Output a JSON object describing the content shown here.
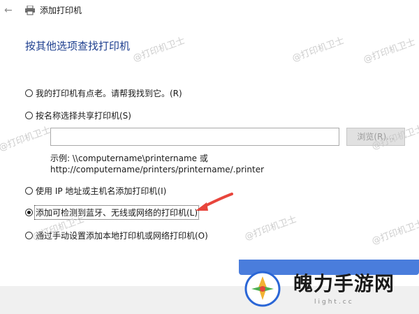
{
  "window": {
    "title": "添加打印机"
  },
  "heading": "按其他选项查找打印机",
  "options": [
    {
      "label": "我的打印机有点老。请帮我找到它。(R)",
      "checked": false
    },
    {
      "label": "按名称选择共享打印机(S)",
      "checked": false
    },
    {
      "label": "使用 IP 地址或主机名添加打印机(I)",
      "checked": false
    },
    {
      "label": "添加可检测到蓝牙、无线或网络的打印机(L)",
      "checked": true
    },
    {
      "label": "通过手动设置添加本地打印机或网络打印机(O)",
      "checked": false
    }
  ],
  "share_input": {
    "value": ""
  },
  "browse_label": "浏览(R)...",
  "example_line1": "示例: \\\\computername\\printername 或",
  "example_line2": "http://computername/printers/printername/.printer",
  "watermarks": [
    "@打印机卫士",
    "@打印机卫士",
    "@打印机卫士",
    "@打印机卫士",
    "@打印机卫士",
    "@打印机卫士",
    "@打印机卫士",
    "@打印机卫士"
  ],
  "logo": {
    "name": "魄力手游网",
    "url": "light.cc"
  },
  "colors": {
    "heading": "#1e3f8f",
    "arrow": "#e8453c",
    "brand_blue": "#2a66d6"
  },
  "icons": {
    "back": "back-arrow-icon",
    "printer": "printer-icon"
  }
}
